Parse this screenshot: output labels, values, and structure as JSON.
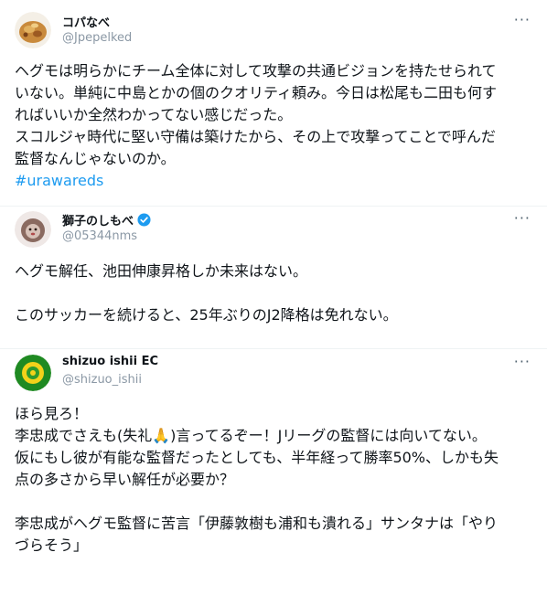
{
  "posts": [
    {
      "name": "コパなべ",
      "handle": "@Jpepelked",
      "more_label": "···",
      "lines": [
        "ヘグモは明らかにチーム全体に対して攻撃の共通ビジョンを持たせられて",
        "いない。単純に中島とかの個のクオリティ頼み。今日は松尾も二田も何す",
        "ればいいか全然わかってない感じだった。",
        "スコルジャ時代に堅い守備は築けたから、その上で攻撃ってことで呼んだ",
        "監督なんじゃないのか。"
      ],
      "hashtag": "#urawareds"
    },
    {
      "name": "獅子のしもべ",
      "handle": "@05344nms",
      "more_label": "···",
      "lines": [
        "ヘグモ解任、池田伸康昇格しか未来はない。",
        "",
        "このサッカーを続けると、25年ぶりのJ2降格は免れない。"
      ]
    },
    {
      "name": "shizuo ishii EC",
      "handle": "@shizuo_ishii",
      "more_label": "···",
      "lines": [
        "ほら見ろ！",
        "李忠成でさえも(失礼🙏)言ってるぞー！Jリーグの監督には向いてない。",
        "仮にもし彼が有能な監督だったとしても、半年経って勝率50%、しかも失",
        "点の多さから早い解任が必要か？",
        "",
        "李忠成がヘグモ監督に苦言「伊藤敦樹も浦和も潰れる」サンタナは「やり",
        "づらそう」"
      ]
    }
  ],
  "colors": {
    "text": "#0f1419",
    "handle": "#8b98a5",
    "hashtag": "#1d9bf0",
    "verified": "#1d9bf0",
    "avatar3_bg": "#1f8a22"
  }
}
